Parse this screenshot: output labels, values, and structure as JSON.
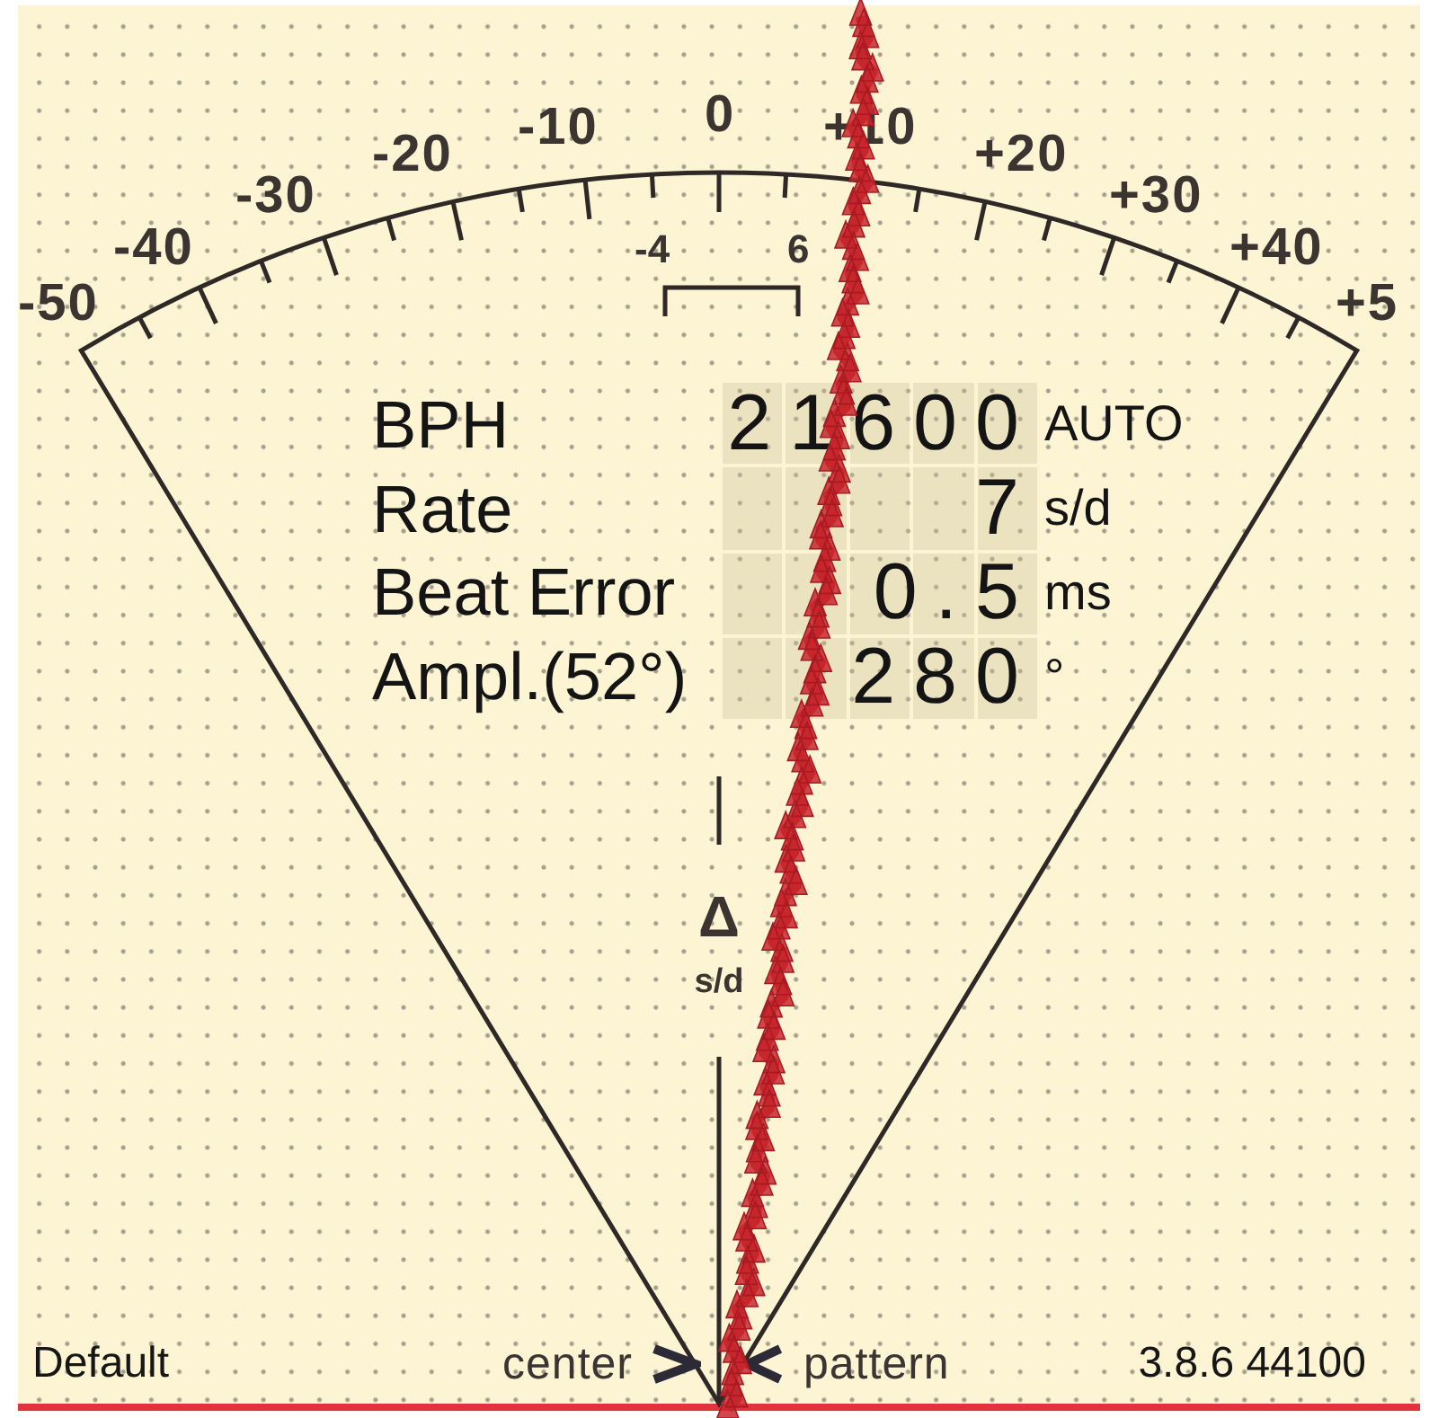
{
  "dial": {
    "scale_labels": [
      "-50",
      "-40",
      "-30",
      "-20",
      "-10",
      "0",
      "+10",
      "+20",
      "+30",
      "+40",
      "+5"
    ],
    "beat_error_labels": [
      "-4",
      "6"
    ]
  },
  "readings": [
    {
      "label": "BPH",
      "value": "21600",
      "unit": "AUTO"
    },
    {
      "label": "Rate",
      "value": "7",
      "unit": "s/d"
    },
    {
      "label": "Beat Error",
      "value": "0.5",
      "unit": "ms"
    },
    {
      "label": "Ampl.(52°)",
      "value": "280",
      "unit": "°"
    }
  ],
  "axis": {
    "symbol": "Δ",
    "unit": "s/d"
  },
  "footer": {
    "profile": "Default",
    "left_mode": "center",
    "right_mode": "pattern",
    "version": "3.8.6 44100"
  }
}
